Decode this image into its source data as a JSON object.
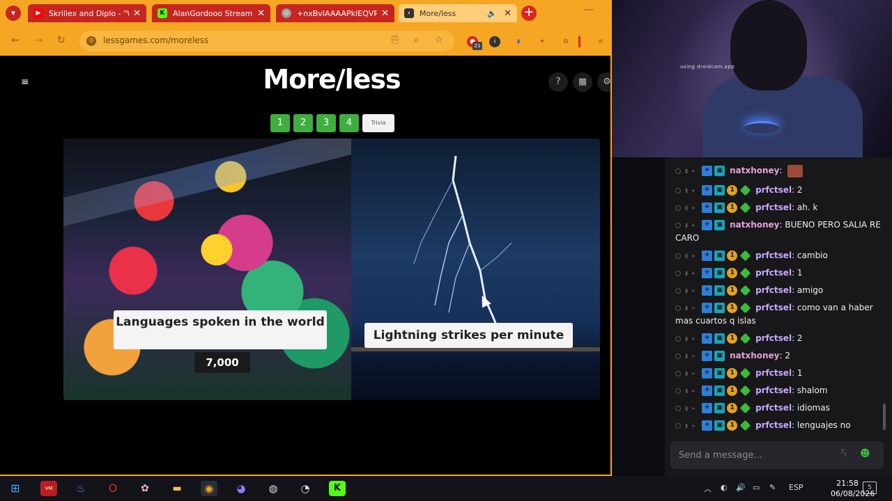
{
  "browser": {
    "tabs": [
      {
        "title": "Skrillex and Diplo - \"W",
        "icon": "youtube-icon",
        "color": "#ff0000"
      },
      {
        "title": "AlanGordooo Stream",
        "icon": "kick-icon",
        "color": "#53fc18"
      },
      {
        "title": "+nxBvIAAAAPkIEQVR",
        "icon": "web-icon",
        "color": "#999999"
      },
      {
        "title": "More/less",
        "icon": "moreless-icon",
        "color": "#333333"
      }
    ],
    "url": "lessgames.com/moreless",
    "ext_badge": "21"
  },
  "game": {
    "title": "More/less",
    "levels": [
      "1",
      "2",
      "3",
      "4"
    ],
    "trivia_label": "Trivia",
    "left_question": "Languages spoken in the world",
    "left_value": "7,000",
    "right_question": "Lightning strikes per minute"
  },
  "webcam": {
    "watermark": "using droidcam.app"
  },
  "chat": {
    "messages": [
      {
        "user": "natxhoney",
        "text": "",
        "badges": 1,
        "avatar": true
      },
      {
        "user": "prfctsel",
        "text": "2",
        "badges": 3
      },
      {
        "user": "prfctsel",
        "text": "ah. k",
        "badges": 3
      },
      {
        "user": "natxhoney",
        "text": "BUENO PERO SALIA RE CARO",
        "badges": 1
      },
      {
        "user": "prfctsel",
        "text": "cambio",
        "badges": 3
      },
      {
        "user": "prfctsel",
        "text": "1",
        "badges": 3
      },
      {
        "user": "prfctsel",
        "text": "amigo",
        "badges": 3
      },
      {
        "user": "prfctsel",
        "text": "como van a haber mas cuartos q islas",
        "badges": 3
      },
      {
        "user": "prfctsel",
        "text": "2",
        "badges": 3
      },
      {
        "user": "natxhoney",
        "text": "2",
        "badges": 1
      },
      {
        "user": "prfctsel",
        "text": "1",
        "badges": 3
      },
      {
        "user": "prfctsel",
        "text": "shalom",
        "badges": 3
      },
      {
        "user": "prfctsel",
        "text": "idiomas",
        "badges": 3
      },
      {
        "user": "prfctsel",
        "text": "lenguajes no",
        "badges": 3
      }
    ],
    "input_placeholder": "Send a message..."
  },
  "taskbar": {
    "language": "ESP",
    "time": "21:58",
    "date": "06/08/2026",
    "notifications": "5"
  }
}
